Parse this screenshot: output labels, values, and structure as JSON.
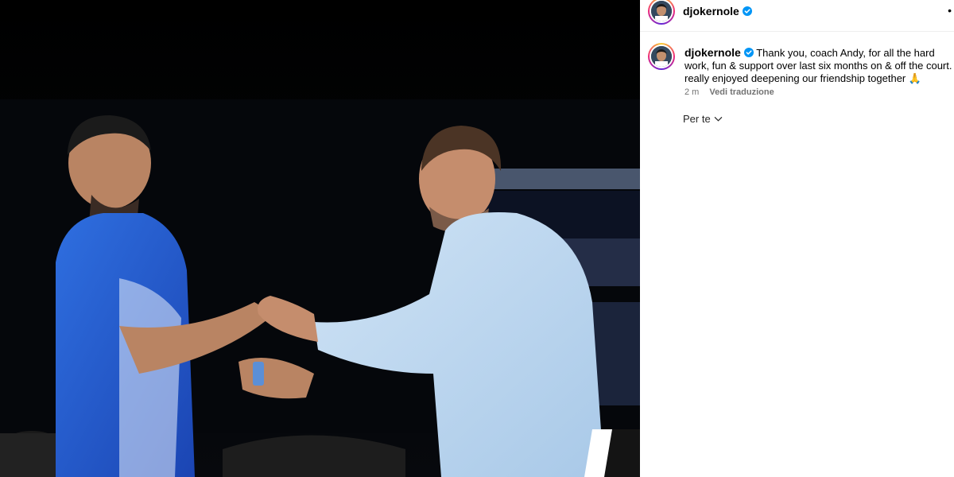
{
  "post": {
    "username": "djokernole",
    "verified": true,
    "more_icon": "more-dots-icon",
    "photo_description_icon": "photo"
  },
  "comment": {
    "username": "djokernole",
    "text": "Thank you, coach Andy, for all the hard work, fun & support over last six months on & off the court. I really enjoyed deepening our friendship together 🙏",
    "time": "2 m",
    "translate_label": "Vedi traduzione"
  },
  "filter": {
    "label": "Per te",
    "icon": "chevron-down-icon"
  },
  "colors": {
    "verified_blue": "#0095f6",
    "meta_gray": "#737373",
    "divider": "#efefef"
  }
}
